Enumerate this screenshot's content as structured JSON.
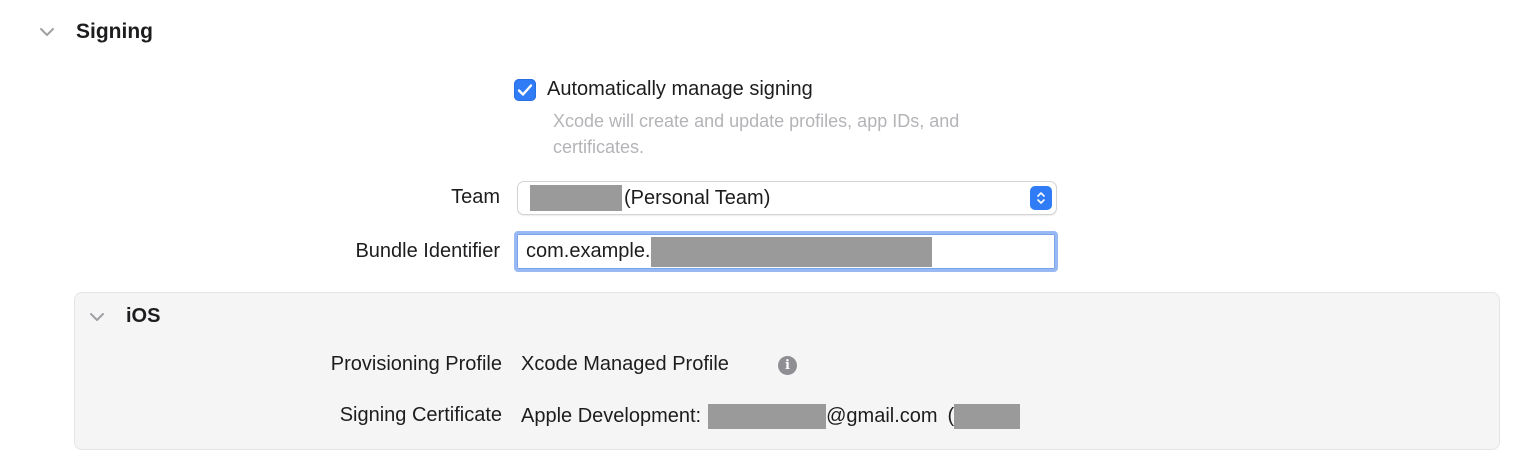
{
  "signing": {
    "title": "Signing",
    "auto_manage_label": "Automatically manage signing",
    "auto_manage_checked": true,
    "auto_manage_description_line1": "Xcode will create and update profiles, app IDs, and",
    "auto_manage_description_line2": "certificates.",
    "team_label": "Team",
    "team_value_suffix": "(Personal Team)",
    "bundle_identifier_label": "Bundle Identifier",
    "bundle_identifier_value": "com.example."
  },
  "ios": {
    "title": "iOS",
    "provisioning_profile_label": "Provisioning Profile",
    "provisioning_profile_value": "Xcode Managed Profile",
    "signing_certificate_label": "Signing Certificate",
    "signing_certificate_prefix": "Apple Development:",
    "signing_certificate_email_suffix": "@gmail.com",
    "signing_certificate_paren": "("
  },
  "icons": {
    "collapse": "chevron-down-icon",
    "check": "checkmark-icon",
    "popup": "up-down-chevron-icon",
    "info": "info-icon"
  },
  "colors": {
    "accent": "#2f7cf6",
    "redaction": "#9a9a9a",
    "focus_ring": "#98b9f3"
  }
}
